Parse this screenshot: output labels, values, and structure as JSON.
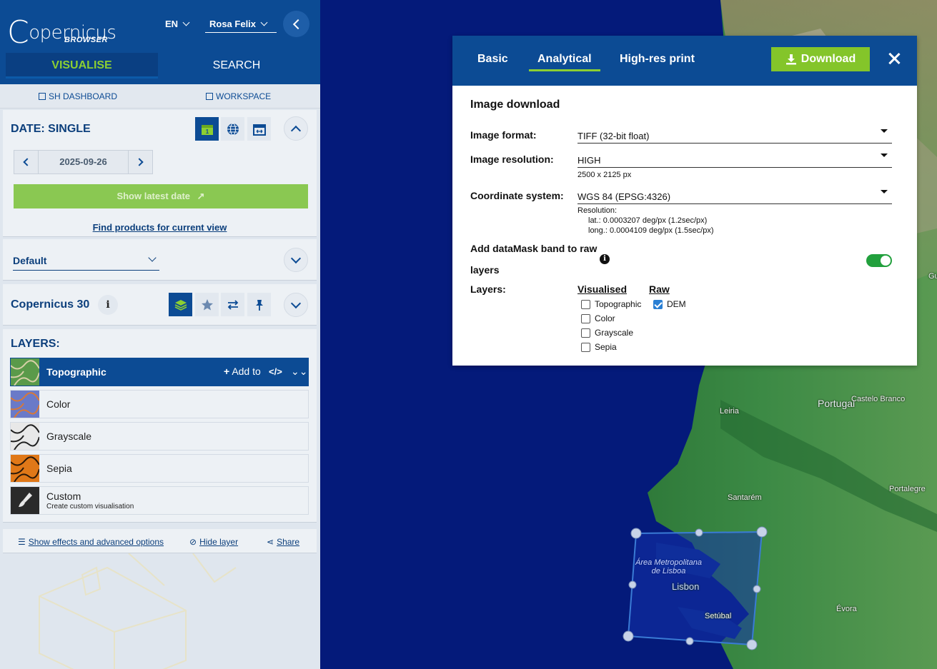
{
  "app": {
    "logo_text": "opernicus",
    "logo_letter": "C",
    "logo_sub": "BROWSER",
    "language": "EN",
    "user": "Rosa Felix"
  },
  "tabs": {
    "visualise": "VISUALISE",
    "search": "SEARCH"
  },
  "links": {
    "dashboard": "SH DASHBOARD",
    "workspace": "WORKSPACE"
  },
  "date_panel": {
    "title": "DATE: SINGLE",
    "date": "2025-09-26",
    "latest_button": "Show latest date",
    "find_link": "Find products for current view"
  },
  "theme": {
    "selected": "Default"
  },
  "collection": {
    "title": "Copernicus 30",
    "info": "i"
  },
  "layers": {
    "heading": "LAYERS:",
    "items": [
      {
        "name": "Topographic",
        "desc": ""
      },
      {
        "name": "Color",
        "desc": ""
      },
      {
        "name": "Grayscale",
        "desc": ""
      },
      {
        "name": "Sepia",
        "desc": ""
      },
      {
        "name": "Custom",
        "desc": "Create custom visualisation"
      }
    ],
    "add_to": "Add to",
    "code": "</>"
  },
  "bottom": {
    "effects": "Show effects and advanced options",
    "hide": "Hide layer",
    "share": "Share"
  },
  "modal": {
    "tabs": [
      "Basic",
      "Analytical",
      "High-res print"
    ],
    "active_tab": "Analytical",
    "download": "Download",
    "heading": "Image download",
    "format_label": "Image format:",
    "format_value": "TIFF (32-bit float)",
    "resolution_label": "Image resolution:",
    "resolution_value": "HIGH",
    "resolution_px": "2500 x 2125 px",
    "crs_label": "Coordinate system:",
    "crs_value": "WGS 84 (EPSG:4326)",
    "res_title": "Resolution:",
    "res_lat": "lat.: 0.0003207 deg/px (1.2sec/px)",
    "res_long": "long.: 0.0004109 deg/px (1.5sec/px)",
    "datamask_label_1": "Add dataMask band to raw",
    "datamask_label_2": "layers",
    "datamask_enabled": true,
    "layers_label": "Layers:",
    "visualised_heading": "Visualised",
    "raw_heading": "Raw",
    "visualised": [
      {
        "name": "Topographic",
        "checked": false
      },
      {
        "name": "Color",
        "checked": false
      },
      {
        "name": "Grayscale",
        "checked": false
      },
      {
        "name": "Sepia",
        "checked": false
      }
    ],
    "raw": [
      {
        "name": "DEM",
        "checked": true
      }
    ]
  },
  "map_labels": {
    "portugal": "Portugal",
    "leiria": "Leiria",
    "castelo_branco": "Castelo Branco",
    "santarem": "Santarém",
    "portalegre": "Portalegre",
    "lisbon": "Lisbon",
    "area_lisboa_1": "Área Metropolitana",
    "area_lisboa_2": "de Lisboa",
    "setubal": "Setúbal",
    "evora": "Évora",
    "guarda": "Guard"
  },
  "colors": {
    "brand_blue": "#0c4b94",
    "accent_green": "#84c52a",
    "toggle_green": "#22a03d",
    "ocean": "#041a7a"
  }
}
